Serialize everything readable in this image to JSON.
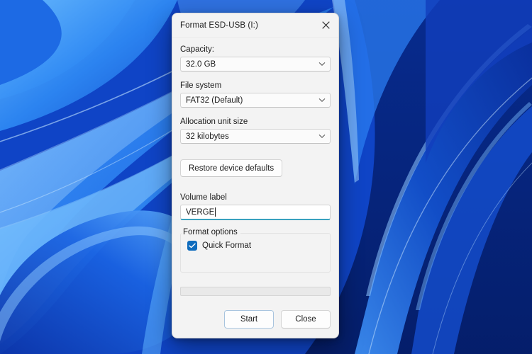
{
  "wallpaper": {
    "name": "windows-bloom-wallpaper",
    "colors": {
      "deep_blue": "#0a2a9c",
      "mid_blue": "#1557d6",
      "bright_blue": "#2f8bf5",
      "light_blue": "#58aaff",
      "dark_navy": "#072a8c"
    }
  },
  "dialog": {
    "title": "Format ESD-USB (I:)",
    "close_label": "Close window",
    "capacity": {
      "label": "Capacity:",
      "value": "32.0 GB"
    },
    "file_system": {
      "label": "File system",
      "value": "FAT32 (Default)"
    },
    "allocation_unit": {
      "label": "Allocation unit size",
      "value": "32 kilobytes"
    },
    "restore_defaults": {
      "label": "Restore device defaults"
    },
    "volume_label": {
      "label": "Volume label",
      "value": "VERGE",
      "placeholder": ""
    },
    "format_options": {
      "title": "Format options",
      "quick_format": {
        "label": "Quick Format",
        "checked": true
      }
    },
    "progress": {
      "name": "format-progress-bar",
      "percent": 0
    },
    "buttons": {
      "start": "Start",
      "close": "Close"
    },
    "accent_color": "#0f6cbd",
    "focus_underline_color": "#3aa2bf"
  }
}
